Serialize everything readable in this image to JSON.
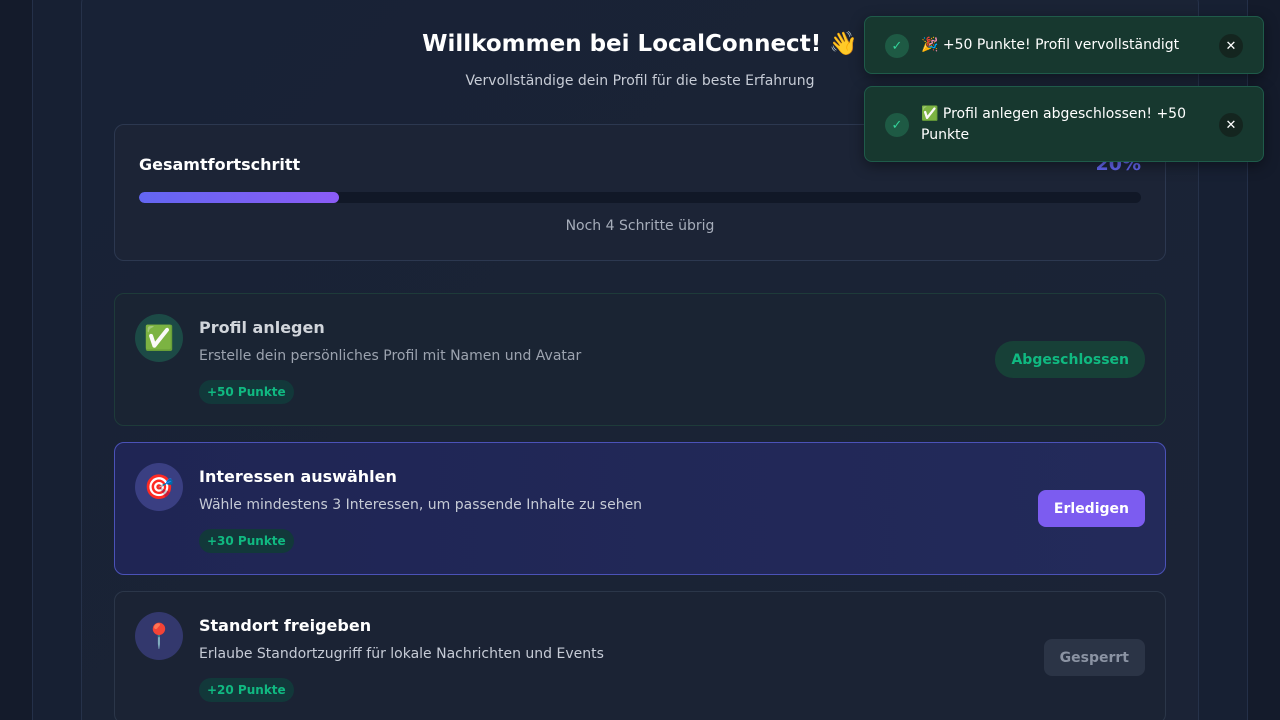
{
  "header": {
    "title": "Willkommen bei LocalConnect! 👋",
    "subtitle": "Vervollständige dein Profil für die beste Erfahrung"
  },
  "progress": {
    "label": "Gesamtfortschritt",
    "percent_text": "20%",
    "percent_value": 20,
    "remaining": "Noch 4 Schritte übrig"
  },
  "steps": [
    {
      "icon": "✅",
      "icon_name": "checkmark-icon",
      "title": "Profil anlegen",
      "description": "Erstelle dein persönliches Profil mit Namen und Avatar",
      "points": "+50 Punkte",
      "button": "Abgeschlossen",
      "state": "done"
    },
    {
      "icon": "🎯",
      "icon_name": "target-icon",
      "title": "Interessen auswählen",
      "description": "Wähle mindestens 3 Interessen, um passende Inhalte zu sehen",
      "points": "+30 Punkte",
      "button": "Erledigen",
      "state": "active"
    },
    {
      "icon": "📍",
      "icon_name": "location-pin-icon",
      "title": "Standort freigeben",
      "description": "Erlaube Standortzugriff für lokale Nachrichten und Events",
      "points": "+20 Punkte",
      "button": "Gesperrt",
      "state": "locked"
    }
  ],
  "toasts": [
    {
      "check": "✓",
      "text": "🎉 +50 Punkte! Profil vervollständigt",
      "close": "✕"
    },
    {
      "check": "✓",
      "text": "✅ Profil anlegen abgeschlossen! +50 Punkte",
      "close": "✕"
    }
  ],
  "colors": {
    "accent": "#6366f1",
    "success": "#10b981",
    "button_primary": "#7c5cf0"
  }
}
